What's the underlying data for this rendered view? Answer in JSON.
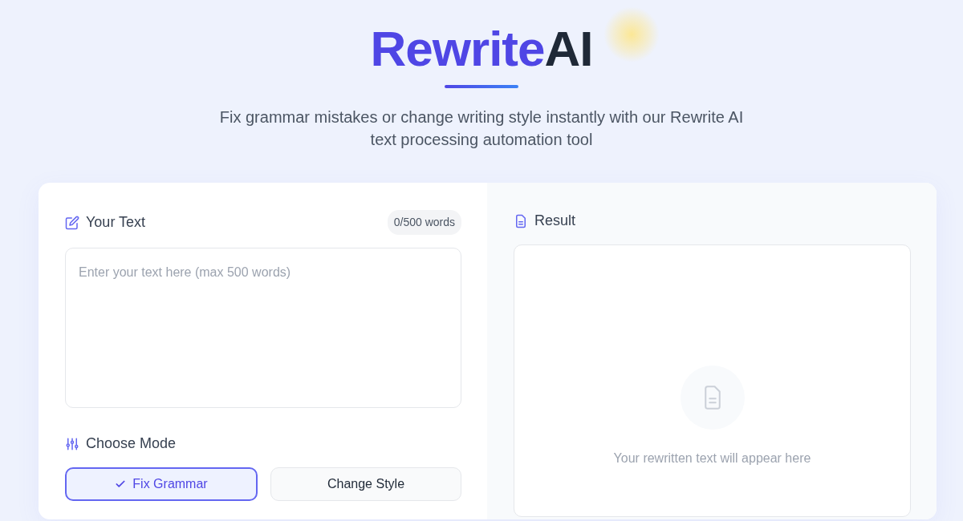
{
  "brand": {
    "primary": "Rewrite",
    "secondary": "AI"
  },
  "subtitle": "Fix grammar mistakes or change writing style instantly with our Rewrite AI text processing automation tool",
  "input_panel": {
    "title": "Your Text",
    "word_count": "0/500 words",
    "placeholder": "Enter your text here (max 500 words)"
  },
  "mode": {
    "title": "Choose Mode",
    "options": [
      {
        "label": "Fix Grammar",
        "selected": true
      },
      {
        "label": "Change Style",
        "selected": false
      }
    ]
  },
  "result_panel": {
    "title": "Result",
    "empty_message": "Your rewritten text will appear here"
  }
}
